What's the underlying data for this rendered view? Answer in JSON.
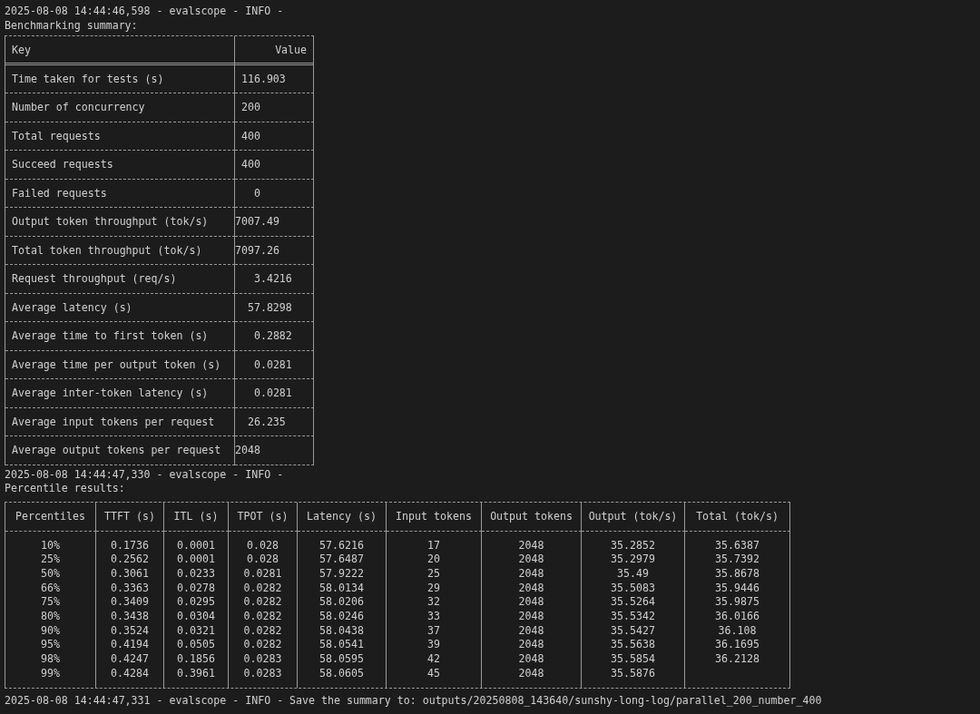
{
  "summary_log": "2025-08-08 14:44:46,598 - evalscope - INFO -",
  "summary_heading": "Benchmarking summary:",
  "summary_table": {
    "columns": [
      "Key",
      "Value"
    ],
    "rows": [
      {
        "key": "Time taken for tests (s)",
        "value": "116.903"
      },
      {
        "key": "Number of concurrency",
        "value": "200"
      },
      {
        "key": "Total requests",
        "value": "400"
      },
      {
        "key": "Succeed requests",
        "value": "400"
      },
      {
        "key": "Failed requests",
        "value": "0"
      },
      {
        "key": "Output token throughput (tok/s)",
        "value": "7007.49"
      },
      {
        "key": "Total token throughput (tok/s)",
        "value": "7097.26"
      },
      {
        "key": "Request throughput (req/s)",
        "value": "3.4216"
      },
      {
        "key": "Average latency (s)",
        "value": "57.8298"
      },
      {
        "key": "Average time to first token (s)",
        "value": "0.2882"
      },
      {
        "key": "Average time per output token (s)",
        "value": "0.0281"
      },
      {
        "key": "Average inter-token latency (s)",
        "value": "0.0281"
      },
      {
        "key": "Average input tokens per request",
        "value": "26.235"
      },
      {
        "key": "Average output tokens per request",
        "value": "2048"
      }
    ]
  },
  "percentile_log": "2025-08-08 14:44:47,330 - evalscope - INFO -",
  "percentile_heading": "Percentile results:",
  "percentile_table": {
    "columns": [
      "Percentiles",
      "TTFT (s)",
      "ITL (s)",
      "TPOT (s)",
      "Latency (s)",
      "Input tokens",
      "Output tokens",
      "Output (tok/s)",
      "Total (tok/s)"
    ],
    "rows": [
      [
        "10%",
        "0.1736",
        "0.0001",
        "0.028",
        "57.6216",
        "17",
        "2048",
        "35.2852",
        "35.6387"
      ],
      [
        "25%",
        "0.2562",
        "0.0001",
        "0.028",
        "57.6487",
        "20",
        "2048",
        "35.2979",
        "35.7392"
      ],
      [
        "50%",
        "0.3061",
        "0.0233",
        "0.0281",
        "57.9222",
        "25",
        "2048",
        "35.49",
        "35.8678"
      ],
      [
        "66%",
        "0.3363",
        "0.0278",
        "0.0282",
        "58.0134",
        "29",
        "2048",
        "35.5083",
        "35.9446"
      ],
      [
        "75%",
        "0.3409",
        "0.0295",
        "0.0282",
        "58.0206",
        "32",
        "2048",
        "35.5264",
        "35.9875"
      ],
      [
        "80%",
        "0.3438",
        "0.0304",
        "0.0282",
        "58.0246",
        "33",
        "2048",
        "35.5342",
        "36.0166"
      ],
      [
        "90%",
        "0.3524",
        "0.0321",
        "0.0282",
        "58.0438",
        "37",
        "2048",
        "35.5427",
        "36.108"
      ],
      [
        "95%",
        "0.4194",
        "0.0505",
        "0.0282",
        "58.0541",
        "39",
        "2048",
        "35.5638",
        "36.1695"
      ],
      [
        "98%",
        "0.4247",
        "0.1856",
        "0.0283",
        "58.0595",
        "42",
        "2048",
        "35.5854",
        "36.2128"
      ],
      [
        "99%",
        "0.4284",
        "0.3961",
        "0.0283",
        "58.0605",
        "45",
        "2048",
        "35.5876"
      ]
    ]
  },
  "save_log": "2025-08-08 14:44:47,331 - evalscope - INFO - Save the summary to: outputs/20250808_143640/sunshy-long-log/parallel_200_number_400"
}
